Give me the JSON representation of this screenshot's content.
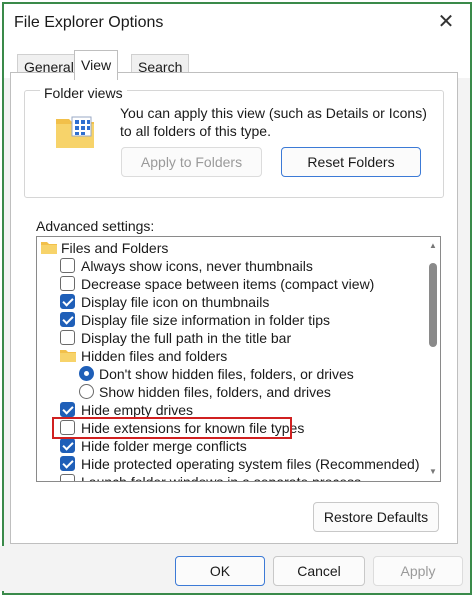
{
  "window": {
    "title": "File Explorer Options",
    "close_glyph": "✕",
    "accent": "#3a8a4a"
  },
  "tabs": [
    {
      "label": "General",
      "selected": false
    },
    {
      "label": "View",
      "selected": true
    },
    {
      "label": "Search",
      "selected": false
    }
  ],
  "folder_views": {
    "label": "Folder views",
    "description": "You can apply this view (such as Details or Icons) to all folders of this type.",
    "apply_button": "Apply to Folders",
    "reset_button": "Reset Folders"
  },
  "advanced": {
    "label": "Advanced settings:",
    "items": [
      {
        "type": "folder",
        "label": "Files and Folders"
      },
      {
        "type": "checkbox",
        "label": "Always show icons, never thumbnails",
        "checked": false
      },
      {
        "type": "checkbox",
        "label": "Decrease space between items (compact view)",
        "checked": false
      },
      {
        "type": "checkbox",
        "label": "Display file icon on thumbnails",
        "checked": true
      },
      {
        "type": "checkbox",
        "label": "Display file size information in folder tips",
        "checked": true
      },
      {
        "type": "checkbox",
        "label": "Display the full path in the title bar",
        "checked": false
      },
      {
        "type": "folder",
        "label": "Hidden files and folders"
      },
      {
        "type": "radio",
        "label": "Don't show hidden files, folders, or drives",
        "checked": true
      },
      {
        "type": "radio",
        "label": "Show hidden files, folders, and drives",
        "checked": false
      },
      {
        "type": "checkbox",
        "label": "Hide empty drives",
        "checked": true
      },
      {
        "type": "checkbox",
        "label": "Hide extensions for known file types",
        "checked": false,
        "highlighted": true
      },
      {
        "type": "checkbox",
        "label": "Hide folder merge conflicts",
        "checked": true
      },
      {
        "type": "checkbox",
        "label": "Hide protected operating system files (Recommended)",
        "checked": true
      },
      {
        "type": "checkbox",
        "label": "Launch folder windows in a separate process",
        "checked": false
      }
    ],
    "highlight_color": "#d02020",
    "check_color": "#1f5fb8"
  },
  "restore_button": "Restore Defaults",
  "footer": {
    "ok": "OK",
    "cancel": "Cancel",
    "apply": "Apply"
  }
}
